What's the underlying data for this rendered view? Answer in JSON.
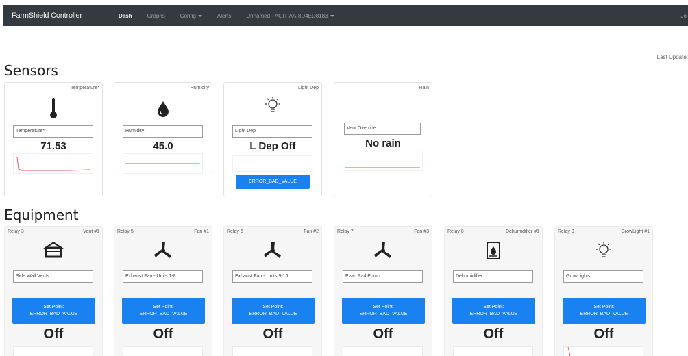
{
  "navbar": {
    "brand": "FarmShield Controller",
    "items": [
      "Dash",
      "Graphs",
      "Config",
      "Alerts",
      "Unnamed - AGIT-AA-8D4ED8183"
    ],
    "user": "Jo"
  },
  "last_updated": "Last Update:",
  "sections": {
    "sensors": "Sensors",
    "equipment": "Equipment"
  },
  "sensors": [
    {
      "header": "Temperature*",
      "icon": "thermometer-icon",
      "field": "Temperature*",
      "value": "71.53"
    },
    {
      "header": "Humidity",
      "icon": "droplet-icon",
      "field": "Humidity",
      "value": "45.0"
    },
    {
      "header": "Light Dep",
      "icon": "lightbulb-icon",
      "field": "Light Dep",
      "value": "L Dep Off",
      "button": "ERROR_BAD_VALUE"
    },
    {
      "header": "Rain",
      "icon": "",
      "field": "Vent Override",
      "value": "No rain"
    }
  ],
  "equipment": [
    {
      "relay": "Relay 3",
      "name": "Vent #1",
      "icon": "greenhouse-icon",
      "field": "Side Wall Vents",
      "setpoint_label": "Set Point:",
      "setpoint_value": "ERROR_BAD_VALUE",
      "state": "Off"
    },
    {
      "relay": "Relay 5",
      "name": "Fan #1",
      "icon": "fan-icon",
      "field": "Exhaust Fan - Units 1-8",
      "setpoint_label": "Set Point:",
      "setpoint_value": "ERROR_BAD_VALUE",
      "state": "Off"
    },
    {
      "relay": "Relay 6",
      "name": "Fan #2",
      "icon": "fan-icon",
      "field": "Exhaust Fan - Units 9-16",
      "setpoint_label": "Set Point:",
      "setpoint_value": "ERROR_BAD_VALUE",
      "state": "Off"
    },
    {
      "relay": "Relay 7",
      "name": "Fan #3",
      "icon": "fan-icon",
      "field": "Evap Pad Pump",
      "setpoint_label": "Set Point:",
      "setpoint_value": "ERROR_BAD_VALUE",
      "state": "Off"
    },
    {
      "relay": "Relay 8",
      "name": "Dehumidifier #1",
      "icon": "dehumidifier-icon",
      "field": "Dehumidifier",
      "setpoint_label": "Set Point:",
      "setpoint_value": "ERROR_BAD_VALUE",
      "state": "Off"
    },
    {
      "relay": "Relay 9",
      "name": "GrowLight #1",
      "icon": "lightbulb-icon",
      "field": "GrowLights",
      "setpoint_label": "Set Point:",
      "setpoint_value": "ERROR_BAD_VALUE",
      "state": "Off"
    }
  ],
  "colors": {
    "navbar": "#343a40",
    "button": "#1a82f0",
    "sparkline": "#e05a5a"
  }
}
